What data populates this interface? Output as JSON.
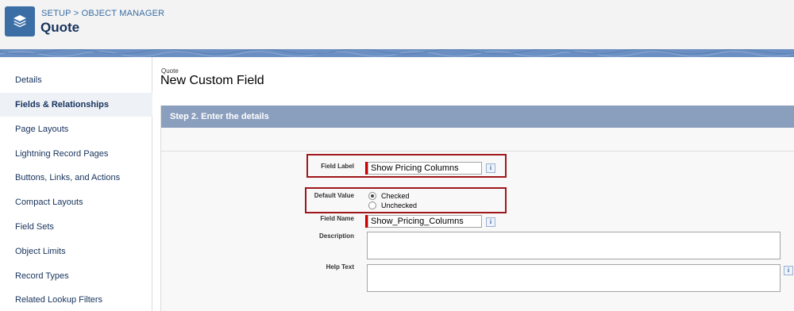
{
  "header": {
    "breadcrumb": "SETUP > OBJECT MANAGER",
    "title": "Quote",
    "logo_icon": "layers-icon"
  },
  "sidebar": {
    "items": [
      {
        "label": "Details",
        "active": false
      },
      {
        "label": "Fields & Relationships",
        "active": true
      },
      {
        "label": "Page Layouts",
        "active": false
      },
      {
        "label": "Lightning Record Pages",
        "active": false
      },
      {
        "label": "Buttons, Links, and Actions",
        "active": false
      },
      {
        "label": "Compact Layouts",
        "active": false
      },
      {
        "label": "Field Sets",
        "active": false
      },
      {
        "label": "Object Limits",
        "active": false
      },
      {
        "label": "Record Types",
        "active": false
      },
      {
        "label": "Related Lookup Filters",
        "active": false
      }
    ]
  },
  "main": {
    "object_label": "Quote",
    "heading": "New Custom Field",
    "step_title": "Step 2. Enter the details",
    "form": {
      "field_label": {
        "label": "Field Label",
        "value": "Show Pricing Columns"
      },
      "default_value": {
        "label": "Default Value",
        "options": [
          {
            "label": "Checked",
            "selected": true
          },
          {
            "label": "Unchecked",
            "selected": false
          }
        ]
      },
      "field_name": {
        "label": "Field Name",
        "value": "Show_Pricing_Columns"
      },
      "description": {
        "label": "Description",
        "value": ""
      },
      "help_text": {
        "label": "Help Text",
        "value": ""
      },
      "info_glyph": "i"
    }
  },
  "colors": {
    "brand": "#3a6ea5",
    "step_bar": "#8a9ebe",
    "highlight": "#a0171b",
    "required": "#cc0000"
  }
}
